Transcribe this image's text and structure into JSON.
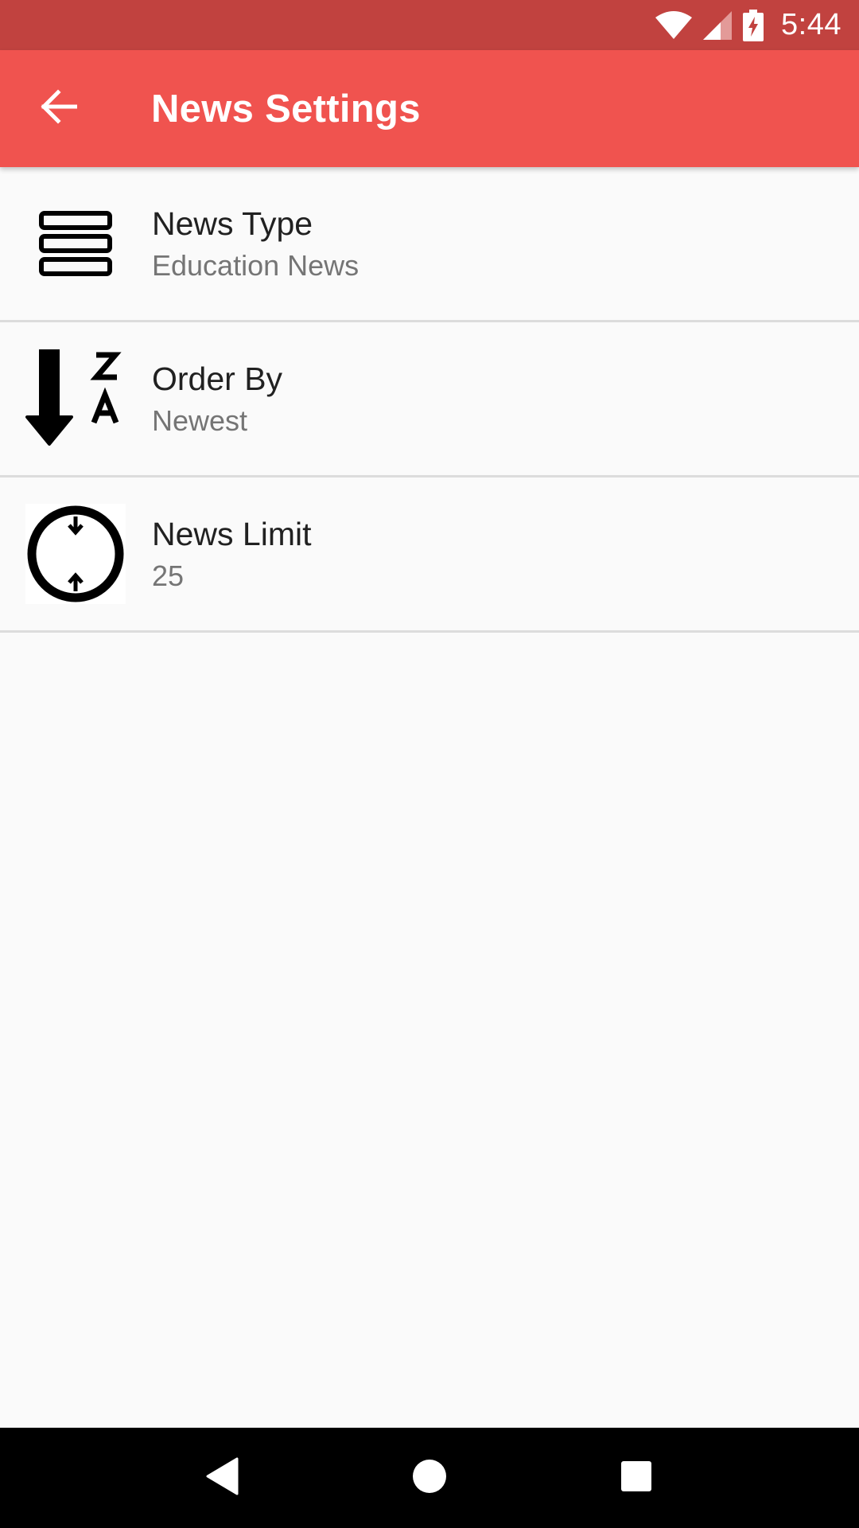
{
  "status_bar": {
    "time": "5:44",
    "icons": [
      "wifi-icon",
      "signal-icon",
      "battery-charging-icon"
    ]
  },
  "app_bar": {
    "title": "News Settings",
    "back_icon": "arrow-back-icon",
    "color": "#f0534f"
  },
  "settings": {
    "items": [
      {
        "icon": "list-rows-icon",
        "title": "News Type",
        "summary": "Education News"
      },
      {
        "icon": "sort-z-a-icon",
        "title": "Order By",
        "summary": "Newest"
      },
      {
        "icon": "limit-circle-icon",
        "title": "News Limit",
        "summary": "25"
      }
    ]
  },
  "nav_bar": {
    "buttons": [
      "back-triangle-icon",
      "home-circle-icon",
      "recents-square-icon"
    ]
  },
  "colors": {
    "status_bar": "#c1423f",
    "app_bar": "#f0534f",
    "background": "#fafafa",
    "title_text": "#212121",
    "summary_text": "#757575"
  }
}
